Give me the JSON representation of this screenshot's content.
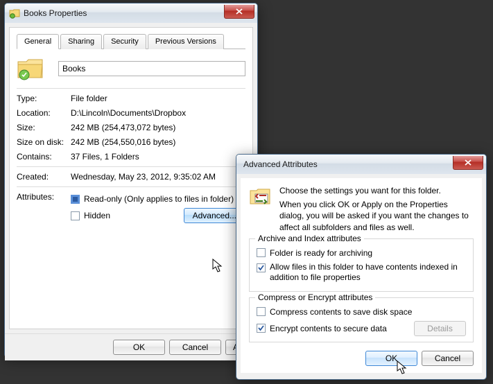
{
  "properties": {
    "title": "Books Properties",
    "tabs": [
      "General",
      "Sharing",
      "Security",
      "Previous Versions"
    ],
    "folder_name": "Books",
    "rows": {
      "type_label": "Type:",
      "type_value": "File folder",
      "location_label": "Location:",
      "location_value": "D:\\Lincoln\\Documents\\Dropbox",
      "size_label": "Size:",
      "size_value": "242 MB (254,473,072 bytes)",
      "size_on_disk_label": "Size on disk:",
      "size_on_disk_value": "242 MB (254,550,016 bytes)",
      "contains_label": "Contains:",
      "contains_value": "37 Files, 1 Folders",
      "created_label": "Created:",
      "created_value": "Wednesday, May 23, 2012, 9:35:02 AM",
      "attributes_label": "Attributes:"
    },
    "attributes": {
      "readonly_label": "Read-only (Only applies to files in folder)",
      "hidden_label": "Hidden",
      "advanced_button": "Advanced..."
    },
    "buttons": {
      "ok": "OK",
      "cancel": "Cancel",
      "apply": "Apply"
    }
  },
  "advanced": {
    "title": "Advanced Attributes",
    "intro1": "Choose the settings you want for this folder.",
    "intro2": "When you click OK or Apply on the Properties dialog, you will be asked if you want the changes to affect all subfolders and files as well.",
    "group1_title": "Archive and Index attributes",
    "archiving_label": "Folder is ready for archiving",
    "indexing_label": "Allow files in this folder to have contents indexed in addition to file properties",
    "group2_title": "Compress or Encrypt attributes",
    "compress_label": "Compress contents to save disk space",
    "encrypt_label": "Encrypt contents to secure data",
    "details_button": "Details",
    "buttons": {
      "ok": "OK",
      "cancel": "Cancel"
    }
  }
}
